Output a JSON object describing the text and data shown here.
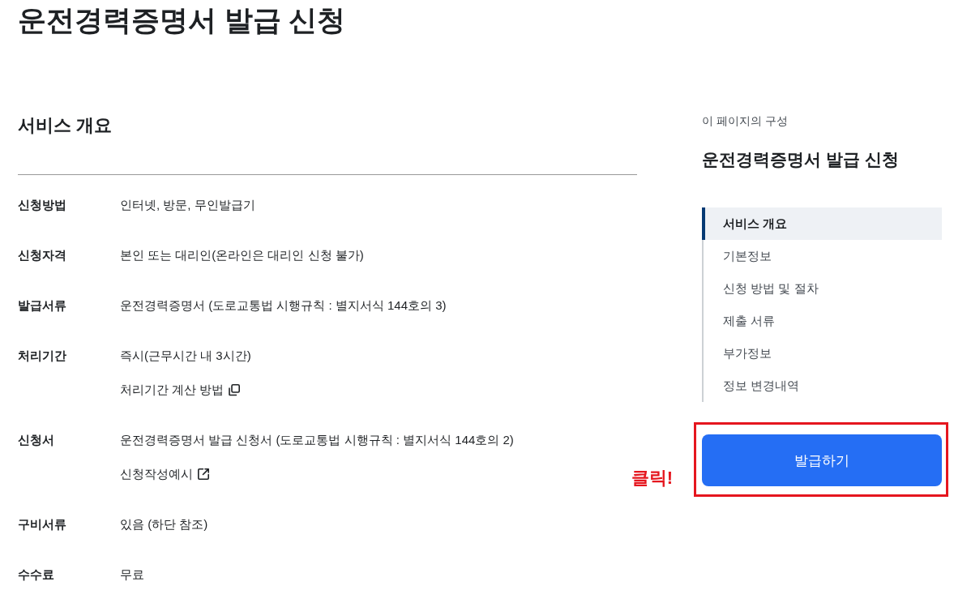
{
  "page_title": "운전경력증명서 발급 신청",
  "overview": {
    "heading": "서비스 개요",
    "rows": [
      {
        "label": "신청방법",
        "lines": [
          {
            "kind": "text",
            "text": "인터넷, 방문, 무인발급기"
          }
        ]
      },
      {
        "label": "신청자격",
        "lines": [
          {
            "kind": "text",
            "text": "본인 또는 대리인(온라인은 대리인 신청 불가)"
          }
        ]
      },
      {
        "label": "발급서류",
        "lines": [
          {
            "kind": "text",
            "text": "운전경력증명서 (도로교통법 시행규칙 : 별지서식 144호의 3)"
          }
        ]
      },
      {
        "label": "처리기간",
        "lines": [
          {
            "kind": "text",
            "text": "즉시(근무시간 내 3시간)"
          },
          {
            "kind": "popup_link",
            "text": "처리기간 계산 방법"
          }
        ]
      },
      {
        "label": "신청서",
        "lines": [
          {
            "kind": "text",
            "text": "운전경력증명서 발급 신청서 (도로교통법 시행규칙 : 별지서식 144호의 2)"
          },
          {
            "kind": "external_link",
            "text": "신청작성예시"
          }
        ]
      },
      {
        "label": "구비서류",
        "lines": [
          {
            "kind": "text",
            "text": "있음 (하단 참조)"
          }
        ]
      },
      {
        "label": "수수료",
        "lines": [
          {
            "kind": "text",
            "text": "무료"
          }
        ]
      }
    ]
  },
  "toc": {
    "caption": "이 페이지의 구성",
    "title": "운전경력증명서 발급 신청",
    "items": [
      {
        "label": "서비스 개요",
        "selected": true
      },
      {
        "label": "기본정보",
        "selected": false
      },
      {
        "label": "신청 방법 및 절차",
        "selected": false
      },
      {
        "label": "제출 서류",
        "selected": false
      },
      {
        "label": "부가정보",
        "selected": false
      },
      {
        "label": "정보 변경내역",
        "selected": false
      }
    ]
  },
  "issue_button": {
    "label": "발급하기",
    "highlighted": true
  },
  "annotation": {
    "text": "클릭!"
  }
}
